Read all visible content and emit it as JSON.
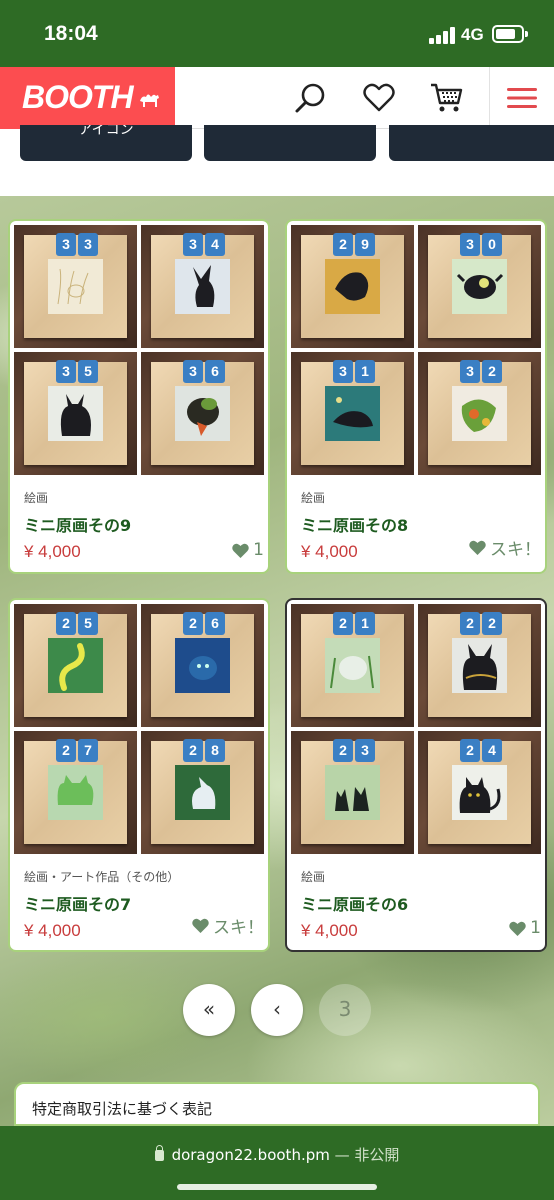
{
  "status_bar": {
    "time": "18:04",
    "network": "4G"
  },
  "header": {
    "logo_text": "BOOTH",
    "icons": [
      "search-icon",
      "heart-icon",
      "cart-icon",
      "hamburger-menu-icon"
    ],
    "accent_color": "#fc4d50"
  },
  "categories": [
    {
      "label": "アイコン"
    },
    {
      "label": ""
    },
    {
      "label": ""
    }
  ],
  "products": [
    {
      "category": "絵画",
      "title": "ミニ原画その9",
      "price": "¥ 4,000",
      "like_label": "1",
      "thumbs": [
        {
          "badge": [
            "3",
            "3"
          ]
        },
        {
          "badge": [
            "3",
            "4"
          ]
        },
        {
          "badge": [
            "3",
            "5"
          ]
        },
        {
          "badge": [
            "3",
            "6"
          ]
        }
      ]
    },
    {
      "category": "絵画",
      "title": "ミニ原画その8",
      "price": "¥ 4,000",
      "like_label": "スキ！",
      "thumbs": [
        {
          "badge": [
            "2",
            "9"
          ]
        },
        {
          "badge": [
            "3",
            "0"
          ]
        },
        {
          "badge": [
            "3",
            "1"
          ]
        },
        {
          "badge": [
            "3",
            "2"
          ]
        }
      ]
    },
    {
      "category": "絵画・アート作品（その他）",
      "title": "ミニ原画その7",
      "price": "¥ 4,000",
      "like_label": "スキ！",
      "thumbs": [
        {
          "badge": [
            "2",
            "5"
          ]
        },
        {
          "badge": [
            "2",
            "6"
          ]
        },
        {
          "badge": [
            "2",
            "7"
          ]
        },
        {
          "badge": [
            "2",
            "8"
          ]
        }
      ]
    },
    {
      "category": "絵画",
      "title": "ミニ原画その6",
      "price": "¥ 4,000",
      "like_label": "1",
      "thumbs": [
        {
          "badge": [
            "2",
            "1"
          ]
        },
        {
          "badge": [
            "2",
            "2"
          ]
        },
        {
          "badge": [
            "2",
            "3"
          ]
        },
        {
          "badge": [
            "2",
            "4"
          ]
        }
      ]
    }
  ],
  "pagination": {
    "first": "«",
    "prev": "‹",
    "current": "3"
  },
  "footer": {
    "legal_link": "特定商取引法に基づく表記"
  },
  "browser": {
    "domain": "doragon22.booth.pm",
    "separator": " — ",
    "visibility": "非公開"
  }
}
